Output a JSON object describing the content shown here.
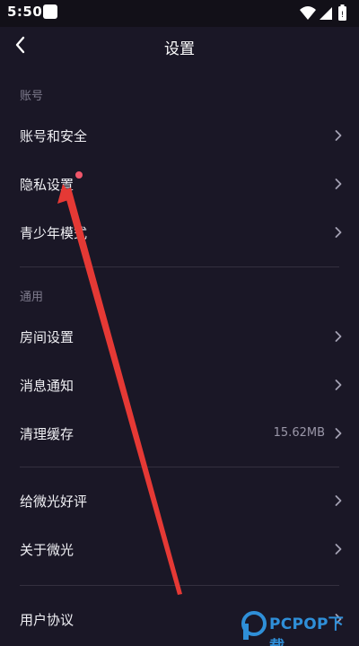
{
  "status_bar": {
    "time": "5:50"
  },
  "header": {
    "title": "设置"
  },
  "sections": [
    {
      "label": "账号",
      "items": [
        {
          "label": "账号和安全"
        },
        {
          "label": "隐私设置"
        },
        {
          "label": "青少年模式"
        }
      ]
    },
    {
      "label": "通用",
      "items": [
        {
          "label": "房间设置"
        },
        {
          "label": "消息通知"
        },
        {
          "label": "清理缓存",
          "value": "15.62MB"
        }
      ]
    },
    {
      "label": "",
      "items": [
        {
          "label": "给微光好评"
        },
        {
          "label": "关于微光"
        }
      ]
    },
    {
      "label": "",
      "items": [
        {
          "label": "用户协议"
        }
      ]
    }
  ],
  "colors": {
    "background": "#1a1726",
    "badge": "#f0566a",
    "arrow": "#e53935"
  },
  "watermark": {
    "text": "PCPOP下载"
  }
}
